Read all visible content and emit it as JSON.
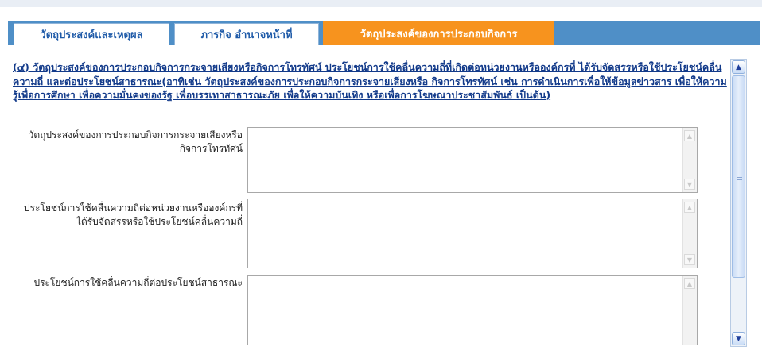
{
  "tabs": [
    {
      "label": "วัตถุประสงค์และเหตุผล",
      "active": false
    },
    {
      "label": "ภารกิจ อำนาจหน้าที่",
      "active": false
    },
    {
      "label": "วัตถุประสงค์ของการประกอบกิจการ",
      "active": true
    }
  ],
  "intro_text": "(๔) วัตถุประสงค์ของการประกอบกิจการกระจายเสียงหรือกิจการโทรทัศน์ ประโยชน์การใช้คลื่นความถี่ที่เกิดต่อหน่วยงานหรือองค์กรที่ ได้รับจัดสรรหรือใช้ประโยชน์คลื่นความถี่ และต่อประโยชน์สาธารณะ(อาทิเช่น วัตถุประสงค์ของการประกอบกิจการกระจายเสียงหรือ กิจการโทรทัศน์ เช่น การดำเนินการเพื่อให้ข้อมูลข่าวสาร เพื่อให้ความรู้เพื่อการศึกษา เพื่อความมั่นคงของรัฐ เพื่อบรรเทาสาธารณะภัย เพื่อให้ความบันเทิง หรือเพื่อการโฆษณาประชาสัมพันธ์ เป็นต้น)",
  "fields": [
    {
      "label": "วัตถุประสงค์ของการประกอบกิจการกระจายเสียงหรือกิจการโทรทัศน์",
      "value": ""
    },
    {
      "label": "ประโยชน์การใช้คลื่นความถี่ต่อหน่วยงานหรือองค์กรที่ได้รับจัดสรรหรือใช้ประโยชน์คลื่นความถี่",
      "value": ""
    },
    {
      "label": "ประโยชน์การใช้คลื่นความถี่ต่อประโยชน์สาธารณะ",
      "value": ""
    }
  ],
  "icons": {
    "scroll_up": "chevron-up-icon",
    "scroll_down": "chevron-down-icon"
  },
  "colors": {
    "tab_bar": "#4f8fc7",
    "active_tab": "#f7931e",
    "inactive_tab_text": "#1e5aa8",
    "intro_text": "#123a8a"
  }
}
